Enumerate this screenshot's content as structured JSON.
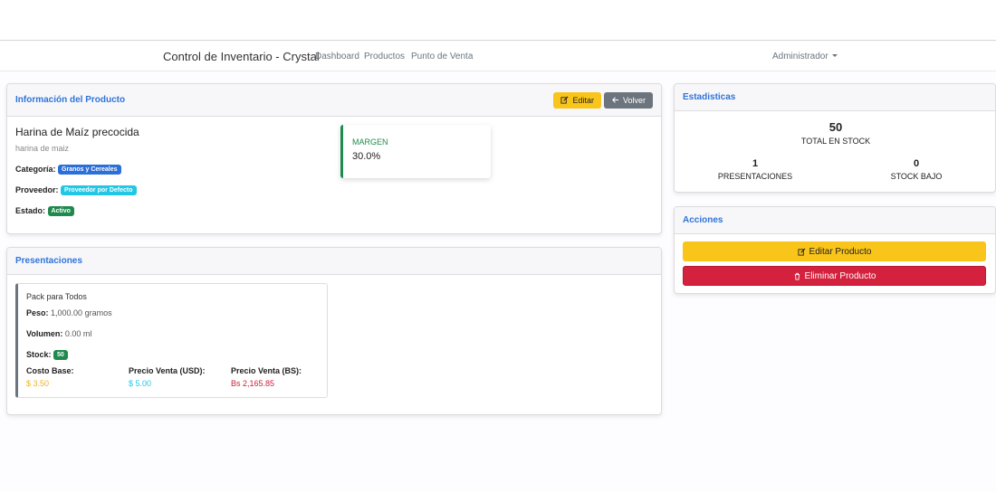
{
  "navbar": {
    "brand": "Control de Inventario - Crystal",
    "links": [
      "Dashboard",
      "Productos",
      "Punto de Venta"
    ],
    "user": "Administrador"
  },
  "product_info": {
    "title": "Información del Producto",
    "edit_label": "Editar",
    "back_label": "Volver",
    "name": "Harina de Maíz precocida",
    "description": "harina de maiz",
    "category_label": "Categoría:",
    "category": "Granos y Cereales",
    "provider_label": "Proveedor:",
    "provider": "Proveedor por Defecto",
    "status_label": "Estado:",
    "status": "Activo",
    "margin_label": "MARGEN",
    "margin_value": "30.0%"
  },
  "presentations": {
    "title": "Presentaciones",
    "items": [
      {
        "name": "Pack para Todos",
        "weight_label": "Peso:",
        "weight": "1,000.00 gramos",
        "volume_label": "Volumen:",
        "volume": "0.00 ml",
        "stock_label": "Stock:",
        "stock": "50",
        "cost_label": "Costo Base:",
        "cost": "$ 3.50",
        "usd_label": "Precio Venta (USD):",
        "usd": "$ 5.00",
        "bs_label": "Precio Venta (BS):",
        "bs": "Bs 2,165.85"
      }
    ]
  },
  "stats": {
    "title": "Estadisticas",
    "total_stock": "50",
    "total_stock_label": "TOTAL EN STOCK",
    "presentations_count": "1",
    "presentations_label": "PRESENTACIONES",
    "low_stock": "0",
    "low_stock_label": "STOCK BAJO"
  },
  "actions": {
    "title": "Acciones",
    "edit_label": "Editar Producto",
    "delete_label": "Eliminar Producto"
  },
  "colors": {
    "accent": "#2f74d9",
    "warning": "#f9c51b",
    "danger": "#d4213d",
    "success": "#1f8a4c",
    "info": "#22c7e6"
  }
}
